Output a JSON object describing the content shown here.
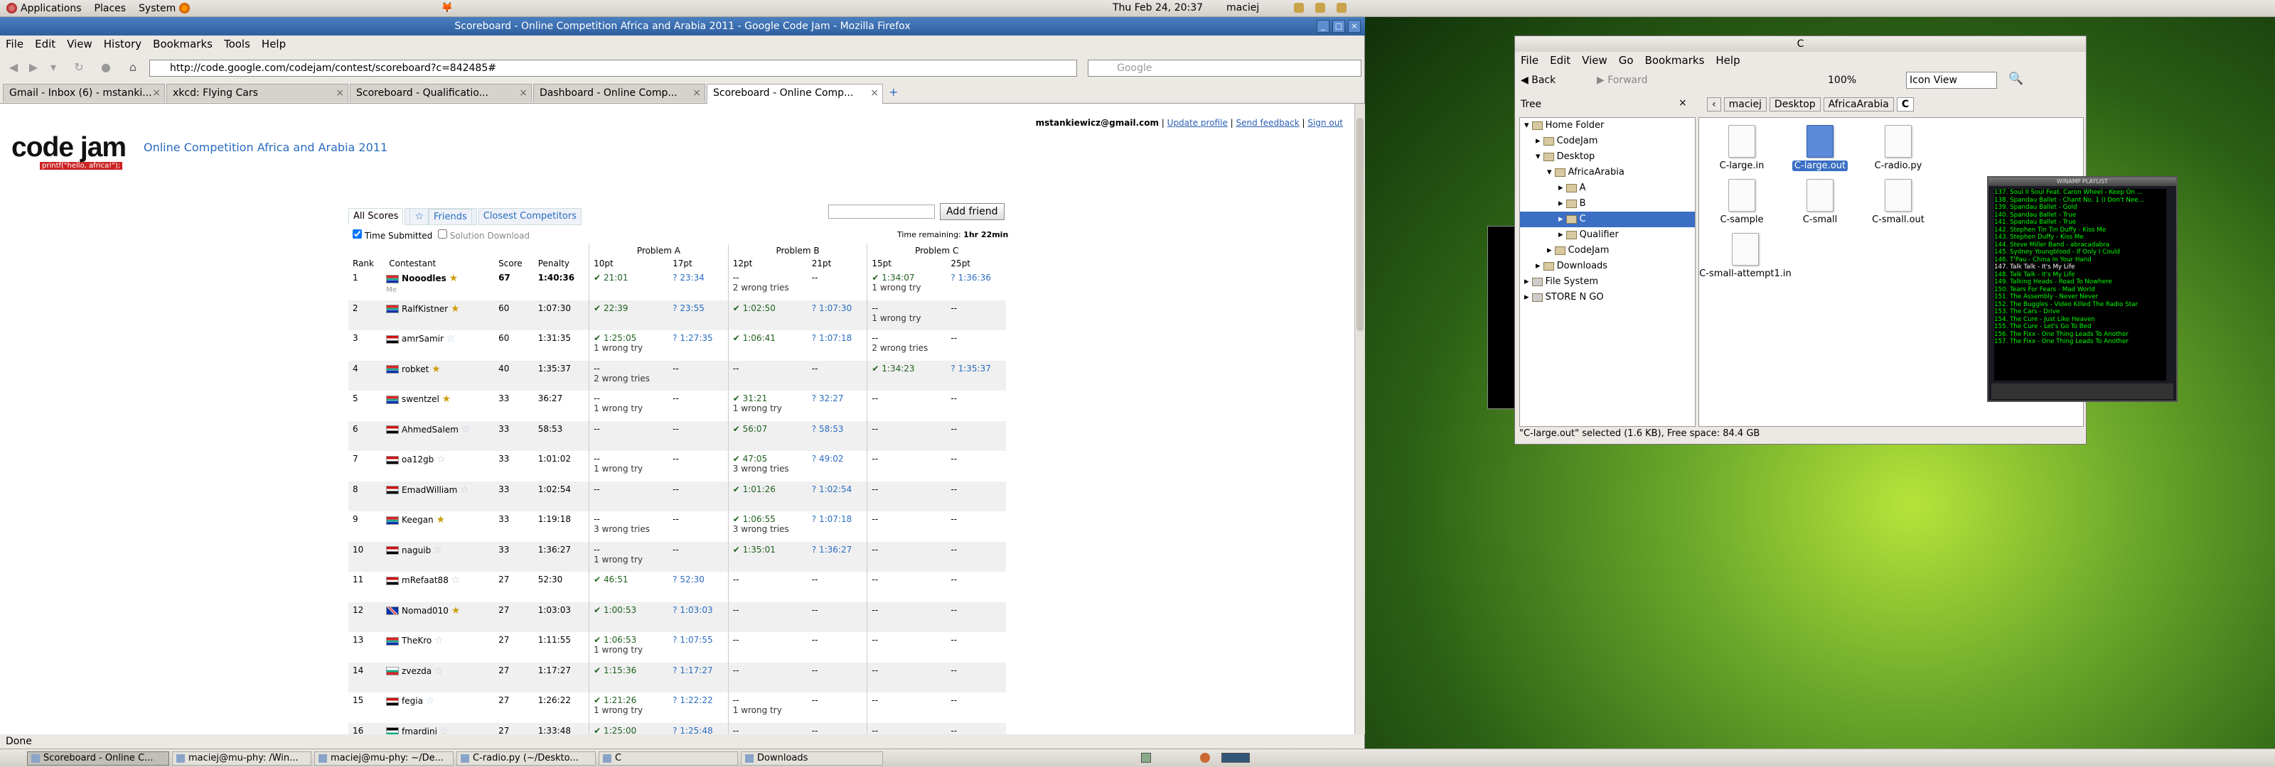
{
  "panel": {
    "menus": [
      "Applications",
      "Places",
      "System"
    ],
    "clock": "Thu Feb 24, 20:37",
    "user": "maciej"
  },
  "firefox": {
    "title": "Scoreboard - Online Competition Africa and Arabia 2011 - Google Code Jam - Mozilla Firefox",
    "menus": [
      "File",
      "Edit",
      "View",
      "History",
      "Bookmarks",
      "Tools",
      "Help"
    ],
    "url": "http://code.google.com/codejam/contest/scoreboard?c=842485#",
    "search_placeholder": "Google",
    "tabs": [
      "Gmail - Inbox (6) - mstanki...",
      "xkcd: Flying Cars",
      "Scoreboard - Qualificatio...",
      "Dashboard - Online Comp...",
      "Scoreboard - Online Comp..."
    ],
    "status": "Done"
  },
  "page": {
    "logo": "code jam",
    "logo_tag": "printf(\"hello, africa!\");",
    "contest_title": "Online Competition Africa and Arabia 2011",
    "email": "mstankiewicz@gmail.com",
    "links": [
      "Update profile",
      "Send feedback",
      "Sign out"
    ],
    "views": [
      "All Scores",
      "Friends",
      "Closest Competitors"
    ],
    "add_friend": "Add friend",
    "time_submitted": "Time Submitted",
    "solution_download": "Solution Download",
    "time_remaining_label": "Time remaining:",
    "time_remaining": "1hr 22min",
    "headers": {
      "rank": "Rank",
      "contestant": "Contestant",
      "score": "Score",
      "penalty": "Penalty",
      "pa": "Problem A",
      "pb": "Problem B",
      "pc": "Problem C",
      "a1": "10pt",
      "a2": "17pt",
      "b1": "12pt",
      "b2": "21pt",
      "c1": "15pt",
      "c2": "25pt"
    },
    "rows": [
      {
        "rank": "1",
        "name": "Nooodles",
        "note": "Me",
        "score": "67",
        "pen": "1:40:36",
        "a1": "✔ 21:01",
        "a2": "? 23:34",
        "b1": "--",
        "b1n": "2 wrong tries",
        "b2": "--",
        "c1": "✔ 1:34:07",
        "c1n": "1 wrong try",
        "c2": "? 1:36:36",
        "flag": "za",
        "star": true
      },
      {
        "rank": "2",
        "name": "RalfKistner",
        "score": "60",
        "pen": "1:07:30",
        "a1": "✔ 22:39",
        "a2": "? 23:55",
        "b1": "✔ 1:02:50",
        "b2": "? 1:07:30",
        "c1": "--",
        "c1n": "1 wrong try",
        "c2": "--",
        "flag": "za",
        "star": true
      },
      {
        "rank": "3",
        "name": "amrSamir",
        "score": "60",
        "pen": "1:31:35",
        "a1": "✔ 1:25:05",
        "a1n": "1 wrong try",
        "a2": "? 1:27:35",
        "b1": "✔ 1:06:41",
        "b2": "? 1:07:18",
        "c1": "--",
        "c1n": "2 wrong tries",
        "c2": "--",
        "flag": "eg",
        "star": false
      },
      {
        "rank": "4",
        "name": "robket",
        "score": "40",
        "pen": "1:35:37",
        "a1": "--",
        "a1n": "2 wrong tries",
        "a2": "--",
        "b1": "--",
        "b2": "--",
        "c1": "✔ 1:34:23",
        "c2": "? 1:35:37",
        "flag": "za",
        "star": true
      },
      {
        "rank": "5",
        "name": "swentzel",
        "score": "33",
        "pen": "36:27",
        "a1": "--",
        "a1n": "1 wrong try",
        "a2": "--",
        "b1": "✔ 31:21",
        "b1n": "1 wrong try",
        "b2": "? 32:27",
        "c1": "--",
        "c2": "--",
        "flag": "za",
        "star": true
      },
      {
        "rank": "6",
        "name": "AhmedSalem",
        "score": "33",
        "pen": "58:53",
        "a1": "--",
        "a2": "--",
        "b1": "✔ 56:07",
        "b2": "? 58:53",
        "c1": "--",
        "c2": "--",
        "flag": "eg",
        "star": false
      },
      {
        "rank": "7",
        "name": "oa12gb",
        "score": "33",
        "pen": "1:01:02",
        "a1": "--",
        "a1n": "1 wrong try",
        "a2": "--",
        "b1": "✔ 47:05",
        "b1n": "3 wrong tries",
        "b2": "? 49:02",
        "c1": "--",
        "c2": "--",
        "flag": "eg",
        "star": false
      },
      {
        "rank": "8",
        "name": "EmadWilliam",
        "score": "33",
        "pen": "1:02:54",
        "a1": "--",
        "a2": "--",
        "b1": "✔ 1:01:26",
        "b2": "? 1:02:54",
        "c1": "--",
        "c2": "--",
        "flag": "eg",
        "star": false
      },
      {
        "rank": "9",
        "name": "Keegan",
        "score": "33",
        "pen": "1:19:18",
        "a1": "--",
        "a1n": "3 wrong tries",
        "a2": "--",
        "b1": "✔ 1:06:55",
        "b1n": "3 wrong tries",
        "b2": "? 1:07:18",
        "c1": "--",
        "c2": "--",
        "flag": "za",
        "star": true
      },
      {
        "rank": "10",
        "name": "naguib",
        "score": "33",
        "pen": "1:36:27",
        "a1": "--",
        "a1n": "1 wrong try",
        "a2": "--",
        "b1": "✔ 1:35:01",
        "b2": "? 1:36:27",
        "c1": "--",
        "c2": "--",
        "flag": "eg",
        "star": false
      },
      {
        "rank": "11",
        "name": "mRefaat88",
        "score": "27",
        "pen": "52:30",
        "a1": "✔ 46:51",
        "a2": "? 52:30",
        "b1": "--",
        "b2": "--",
        "c1": "--",
        "c2": "--",
        "flag": "eg",
        "star": false
      },
      {
        "rank": "12",
        "name": "Nomad010",
        "score": "27",
        "pen": "1:03:03",
        "a1": "✔ 1:00:53",
        "a2": "? 1:03:03",
        "b1": "--",
        "b2": "--",
        "c1": "--",
        "c2": "--",
        "flag": "gb",
        "star": true
      },
      {
        "rank": "13",
        "name": "TheKro",
        "score": "27",
        "pen": "1:11:55",
        "a1": "✔ 1:06:53",
        "a1n": "1 wrong try",
        "a2": "? 1:07:55",
        "b1": "--",
        "b2": "--",
        "c1": "--",
        "c2": "--",
        "flag": "za",
        "star": false
      },
      {
        "rank": "14",
        "name": "zvezda",
        "score": "27",
        "pen": "1:17:27",
        "a1": "✔ 1:15:36",
        "a2": "? 1:17:27",
        "b1": "--",
        "b2": "--",
        "c1": "--",
        "c2": "--",
        "flag": "bg",
        "star": false
      },
      {
        "rank": "15",
        "name": "fegia",
        "score": "27",
        "pen": "1:26:22",
        "a1": "✔ 1:21:26",
        "a1n": "1 wrong try",
        "a2": "? 1:22:22",
        "b1": "--",
        "b1n": "1 wrong try",
        "b2": "--",
        "c1": "--",
        "c2": "--",
        "flag": "eg",
        "star": false
      },
      {
        "rank": "16",
        "name": "fmardini",
        "score": "27",
        "pen": "1:33:48",
        "a1": "✔ 1:25:00",
        "a2": "? 1:25:48",
        "b1": "--",
        "b2": "--",
        "c1": "--",
        "c2": "--",
        "flag": "jo",
        "star": false
      }
    ]
  },
  "nautilus": {
    "title": "C",
    "menus": [
      "File",
      "Edit",
      "View",
      "Go",
      "Bookmarks",
      "Help"
    ],
    "back": "Back",
    "forward": "Forward",
    "zoom": "100%",
    "view": "Icon View",
    "sidebar_label": "Tree",
    "path": [
      "maciej",
      "Desktop",
      "AfricaArabia",
      "C"
    ],
    "tree": [
      "Home Folder",
      "CodeJam",
      "Desktop",
      "AfricaArabia",
      "A",
      "B",
      "C",
      "Qualifier",
      "CodeJam",
      "Downloads",
      "File System",
      "STORE N GO"
    ],
    "files": [
      "C-large.in",
      "C-large.out",
      "C-radio.py",
      "C-sample",
      "C-small",
      "C-small.out",
      "C-small-attempt1.in"
    ],
    "status": "\"C-large.out\" selected (1.6 KB), Free space: 84.4 GB"
  },
  "winamp": {
    "title": "WINAMP PLAYLIST",
    "tracks": [
      "137. Soul II Soul Feat. Caron Wheel - Keep On ...",
      "138. Spandau Ballet - Chant No. 1 (I Don't Nee...",
      "139. Spandau Ballet - Gold",
      "140. Spandau Ballet - True",
      "141. Spandau Ballet - True",
      "142. Stephen Tin Tin Duffy - Kiss Me",
      "143. Stephen Duffy - Kiss Me",
      "144. Steve Miller Band - abracadabra",
      "145. Sydney Youngblood - If Only I Could",
      "146. T'Pau - China In Your Hand",
      "147. Talk Talk - It's My Life",
      "148. Talk Talk - It's My Life",
      "149. Talking Heads - Road To Nowhere",
      "150. Tears For Fears - Mad World",
      "151. The Assembly - Never Never",
      "152. The Buggles - Video Killed The Radio Star",
      "153. The Cars - Drive",
      "154. The Cure - Just Like Heaven",
      "155. The Cure - Let's Go To Bed",
      "156. The Fixx - One Thing Leads To Another",
      "157. The Fixx - One Thing Leads To Another"
    ],
    "current": 10
  },
  "taskbar": [
    "Scoreboard - Online C...",
    "maciej@mu-phy: /Win...",
    "maciej@mu-phy: ~/De...",
    "C-radio.py (~/Deskto...",
    "C",
    "Downloads"
  ]
}
